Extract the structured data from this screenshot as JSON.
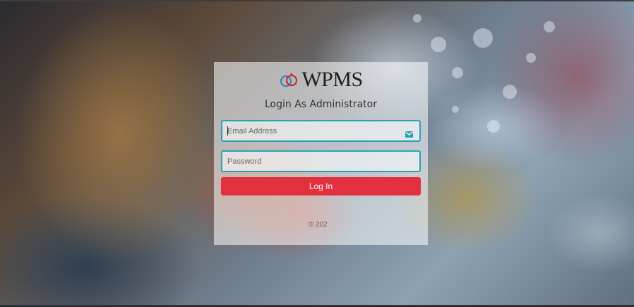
{
  "app": {
    "logo_text": "WPMS"
  },
  "login": {
    "heading": "Login As Administrator",
    "email": {
      "placeholder": "Email Address",
      "value": ""
    },
    "password": {
      "placeholder": "Password",
      "value": ""
    },
    "submit_label": "Log In",
    "footer": "© 202"
  },
  "icons": {
    "logo": "interlocking-rings-icon",
    "email": "envelope-icon"
  },
  "colors": {
    "accent": "#2aa1b3",
    "button": "#e2303f",
    "card_background": "rgba(255,255,255,0.55)"
  }
}
